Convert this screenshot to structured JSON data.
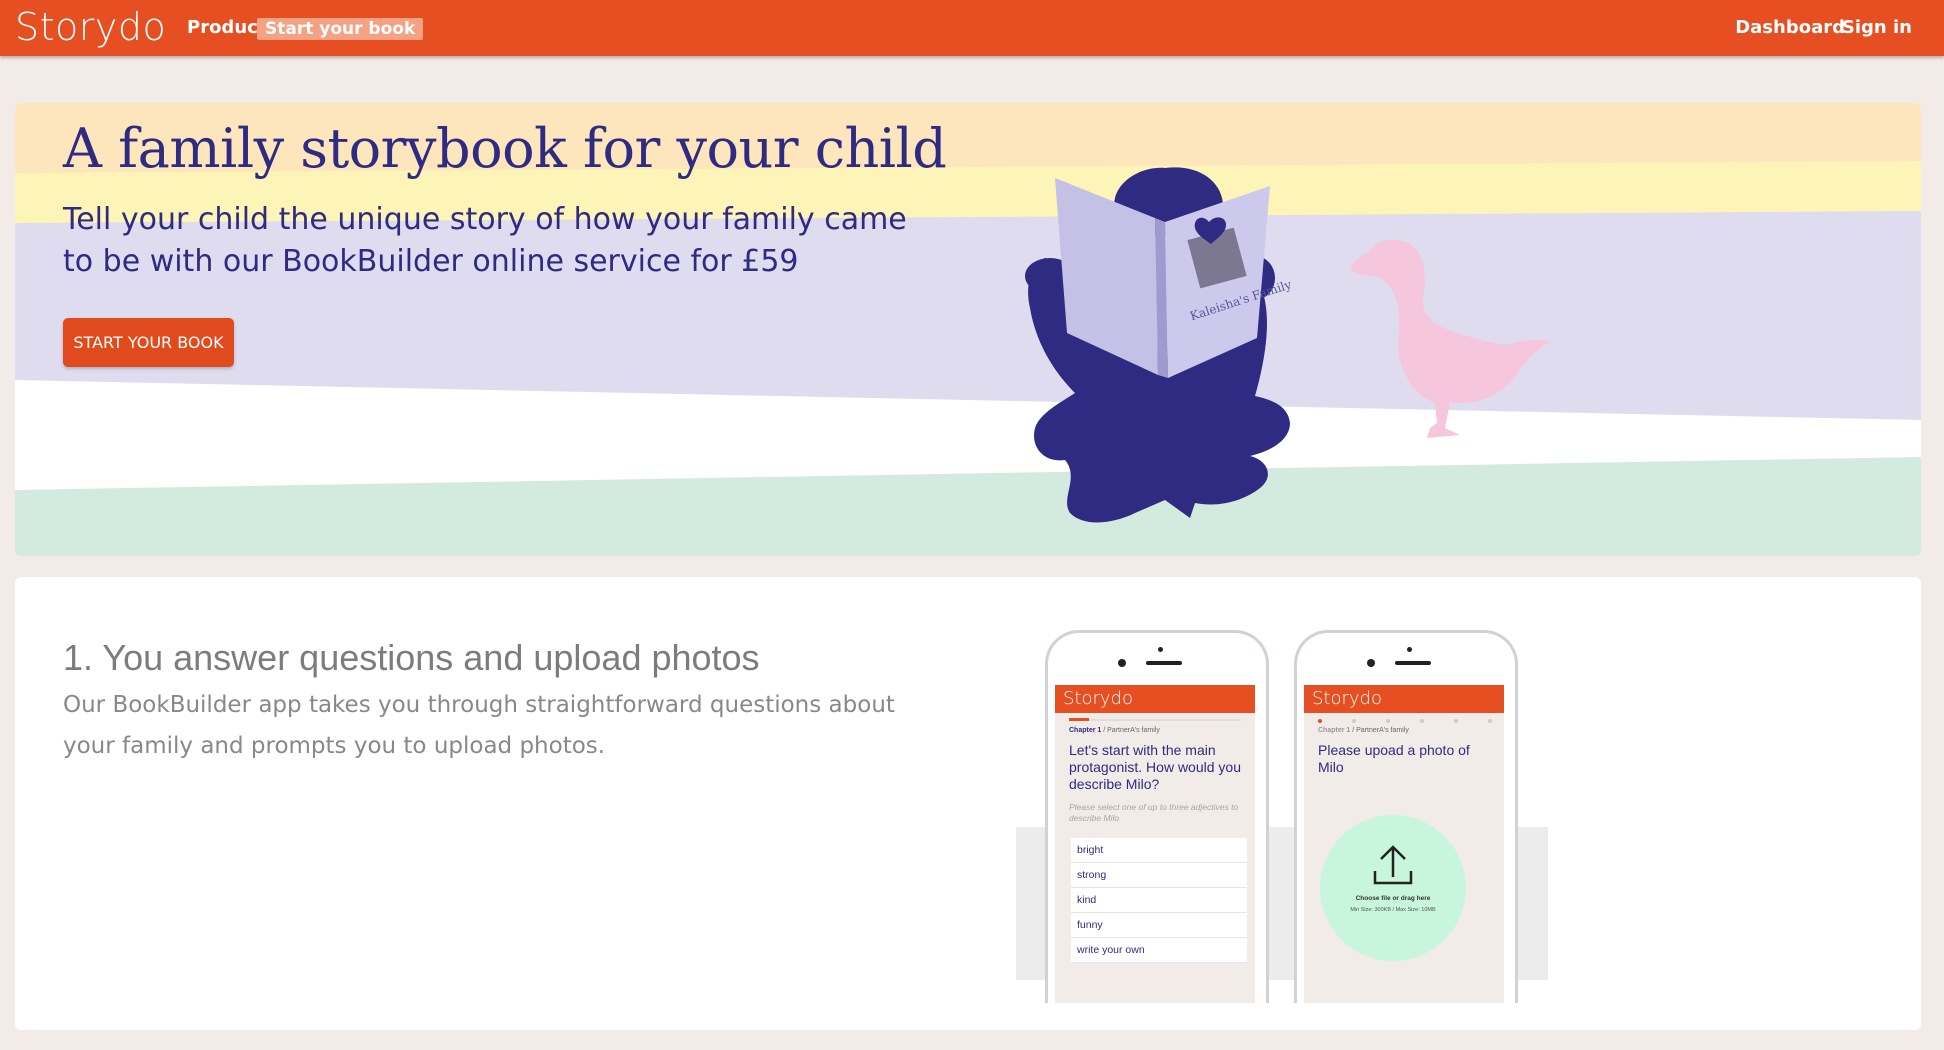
{
  "nav": {
    "logo": "Storydo",
    "links": [
      "Product",
      "Start your book"
    ],
    "right_links": [
      "Dashboard",
      "Sign in"
    ]
  },
  "hero": {
    "title": "A family storybook for your child",
    "subtitle": "Tell your child the unique story of how your family came to be with our BookBuilder online service for £59",
    "button": "START YOUR BOOK",
    "book_cover_text": "Kaleisha's Family"
  },
  "step1": {
    "title": "1. You answer questions and upload photos",
    "description": "Our BookBuilder app takes you through straightforward questions about your family and prompts you to upload photos."
  },
  "phone1": {
    "app_name": "Storydo",
    "chapter": "Chapter 1",
    "chapter_sub": "/ PartnerA's family",
    "question": "Let's start with the main protagonist. How would you describe Milo?",
    "hint": "Please select one of up to three adjectives to describe Milo",
    "options": [
      "bright",
      "strong",
      "kind",
      "funny",
      "write your own"
    ]
  },
  "phone2": {
    "app_name": "Storydo",
    "chapter": "Chapter 1",
    "chapter_sub": "/ PartnerA's family",
    "question": "Please upoad a photo of Milo",
    "upload_label": "Choose file or drag here",
    "upload_limits": "Min Size: 300KB / Max Size: 10MB"
  },
  "colors": {
    "brand": "#e64f21",
    "primary_text": "#2f2a82",
    "band_peach": "#fde6bc",
    "band_yellow": "#fdf4b8",
    "band_lavender": "#dfdcef",
    "band_mint": "#d3eadf",
    "goose": "#f6c6dd"
  }
}
